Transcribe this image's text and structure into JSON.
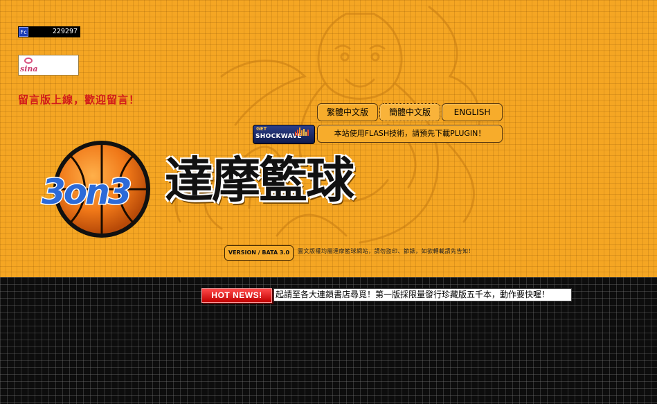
{
  "counter": {
    "badge": "Fc",
    "value": "229297"
  },
  "sina": {
    "label": "sina"
  },
  "guestbook_notice": "留言版上線，歡迎留言！",
  "language_buttons": [
    {
      "label": "繁體中文版"
    },
    {
      "label": "簡體中文版"
    },
    {
      "label": "ENGLISH"
    }
  ],
  "flash_notice": "本站使用FLASH技術，請預先下載PLUGIN！",
  "shockwave": {
    "get": "GET",
    "name": "SHOCKWAVE"
  },
  "logo": {
    "text": "3on3",
    "title": "達摩籃球"
  },
  "version_label": "VERSION / BATA 3.0",
  "copyright_text": "圖文版權均屬達摩籃球網站，請勿盜印、節錄，如欲轉載請先告知！",
  "news": {
    "badge": "HOT NEWS!",
    "ticker": "起請至各大連鎖書店尋覓！第一版採限量發行珍藏版五千本，動作要快喔！"
  },
  "colors": {
    "orange": "#f5a623",
    "dark": "#0d0d0d",
    "accent_red": "#d11a1a"
  }
}
